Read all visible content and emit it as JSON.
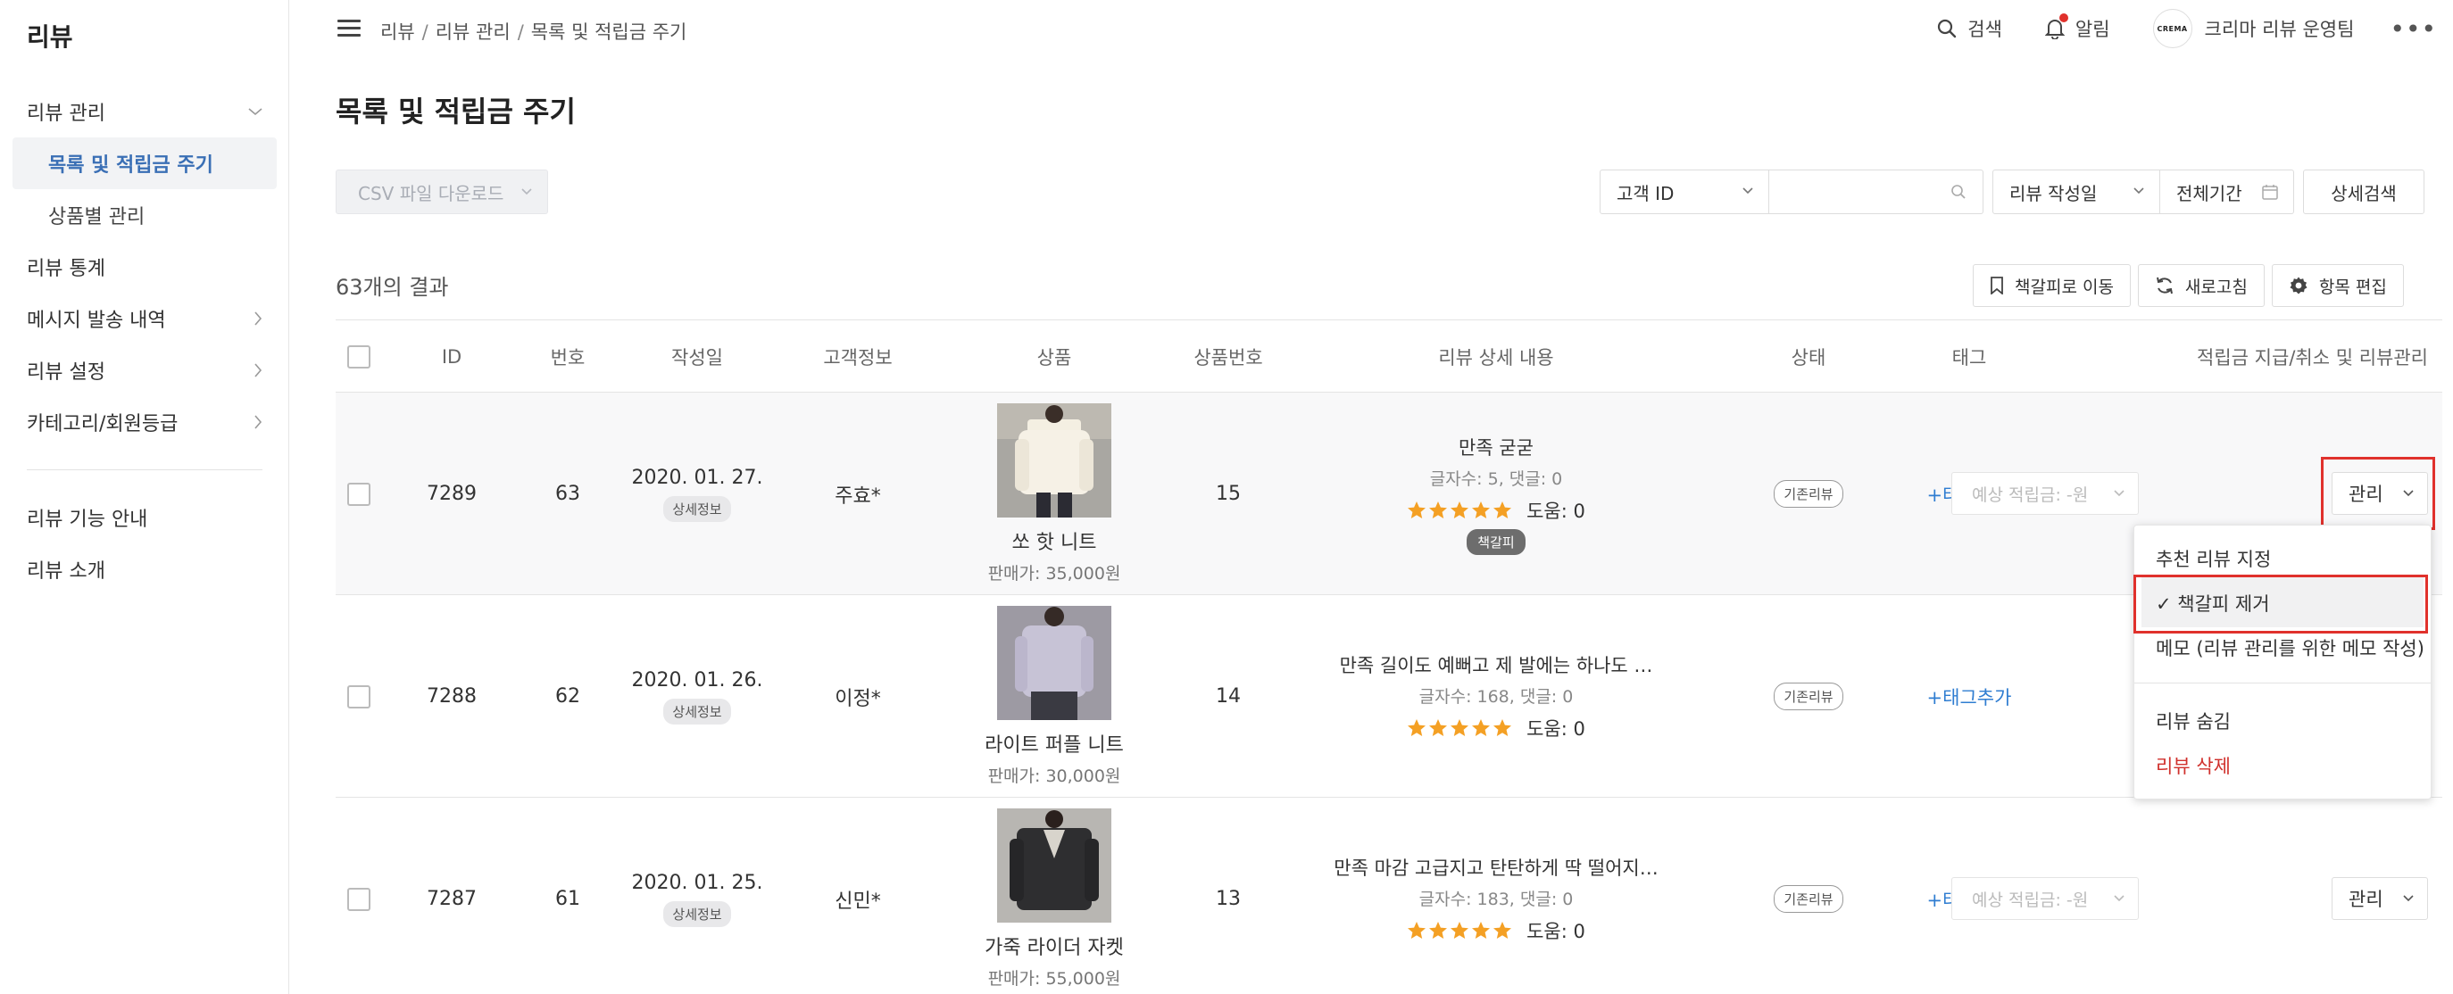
{
  "sidebar": {
    "brand": "리뷰",
    "items": [
      {
        "label": "리뷰 관리"
      },
      {
        "label": "목록 및 적립금 주기"
      },
      {
        "label": "상품별 관리"
      },
      {
        "label": "리뷰 통계"
      },
      {
        "label": "메시지 발송 내역"
      },
      {
        "label": "리뷰 설정"
      },
      {
        "label": "카테고리/회원등급"
      }
    ],
    "bottom": [
      {
        "label": "리뷰 기능 안내"
      },
      {
        "label": "리뷰 소개"
      }
    ]
  },
  "header": {
    "breadcrumb": [
      "리뷰",
      "리뷰 관리",
      "목록 및 적립금 주기"
    ],
    "search_label": "검색",
    "alert_label": "알림",
    "avatar_text": "CREMA",
    "user_name": "크리마 리뷰 운영팀",
    "more": "•••"
  },
  "page": {
    "title": "목록 및 적립금 주기",
    "csv_button": "CSV 파일 다운로드",
    "filter_customer": "고객 ID",
    "filter_input_placeholder": "",
    "filter_date_type": "리뷰 작성일",
    "filter_range": "전체기간",
    "advanced_search": "상세검색",
    "result_count": "63개의 결과",
    "tool_bookmark": "책갈피로 이동",
    "tool_refresh": "새로고침",
    "tool_edit": "항목 편집"
  },
  "table": {
    "headers": [
      "ID",
      "번호",
      "작성일",
      "고객정보",
      "상품",
      "상품번호",
      "리뷰 상세 내용",
      "상태",
      "태그",
      "적립금 지급/취소 및 리뷰관리"
    ],
    "rows": [
      {
        "id": "7289",
        "no": "63",
        "date": "2020. 01. 27.",
        "detail": "상세정보",
        "customer": "주효*",
        "product_name": "쏘 핫 니트",
        "product_price": "판매가: 35,000원",
        "product_no": "15",
        "review_title": "만족 굳굳",
        "review_meta": "글자수: 5, 댓글: 0",
        "helpful": "도움: 0",
        "rating": 5,
        "bookmark_badge": "책갈피",
        "status": "기존리뷰",
        "tag": "+태그추가",
        "points_placeholder": "예상 적립금: -원",
        "manage": "관리"
      },
      {
        "id": "7288",
        "no": "62",
        "date": "2020. 01. 26.",
        "detail": "상세정보",
        "customer": "이정*",
        "product_name": "라이트 퍼플 니트",
        "product_price": "판매가: 30,000원",
        "product_no": "14",
        "review_title": "만족 길이도 예뻐고 제 발에는 하나도 …",
        "review_meta": "글자수: 168, 댓글: 0",
        "helpful": "도움: 0",
        "rating": 5,
        "status": "기존리뷰",
        "tag": "+태그추가"
      },
      {
        "id": "7287",
        "no": "61",
        "date": "2020. 01. 25.",
        "detail": "상세정보",
        "customer": "신민*",
        "product_name": "가죽 라이더 자켓",
        "product_price": "판매가: 55,000원",
        "product_no": "13",
        "review_title": "만족 마감 고급지고 탄탄하게 딱 떨어지…",
        "review_meta": "글자수: 183, 댓글: 0",
        "helpful": "도움: 0",
        "rating": 5,
        "status": "기존리뷰",
        "tag": "+태그추가",
        "points_placeholder": "예상 적립금: -원",
        "manage": "관리"
      }
    ]
  },
  "menu": {
    "items": [
      {
        "label": "추천 리뷰 지정"
      },
      {
        "label": "✓  책갈피 제거"
      },
      {
        "label": "메모 (리뷰 관리를 위한 메모 작성)"
      },
      {
        "label": "리뷰 숨김"
      },
      {
        "label": "리뷰 삭제"
      }
    ]
  },
  "colors": {
    "accent": "#3a6fb5",
    "link": "#2f7dd1",
    "highlight": "#e0312c",
    "star": "#f4a024"
  }
}
